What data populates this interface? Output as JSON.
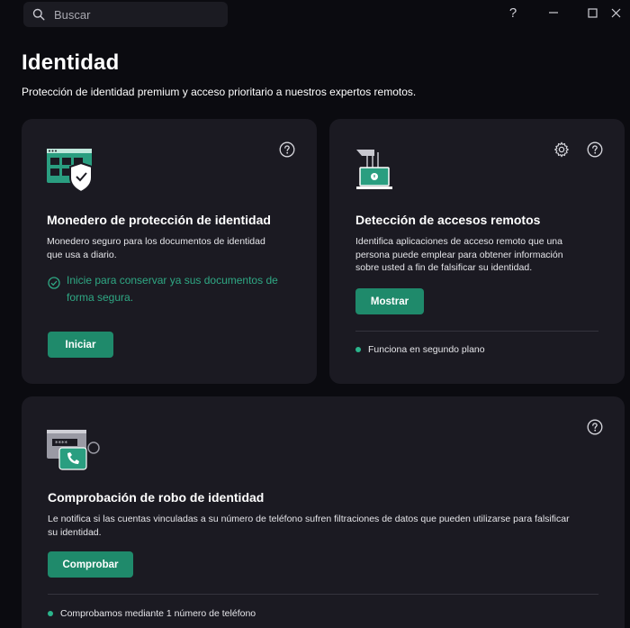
{
  "search": {
    "placeholder": "Buscar"
  },
  "window": {
    "help": "?",
    "minimize": "—",
    "maximize": "☐",
    "close": "✕"
  },
  "page": {
    "title": "Identidad",
    "subtitle": "Protección de identidad premium y acceso prioritario a nuestros expertos remotos."
  },
  "cards": {
    "wallet": {
      "title": "Monedero de protección de identidad",
      "description_line1": "Monedero seguro para los documentos de identidad",
      "description_line2": "que usa a diario.",
      "hint_line1": "Inicie para conservar ya sus documentos de",
      "hint_line2": "forma segura.",
      "button": "Iniciar"
    },
    "remote": {
      "title": "Detección de accesos remotos",
      "description_line1": "Identifica aplicaciones de acceso remoto que una",
      "description_line2": "persona puede emplear para obtener información",
      "description_line3": "sobre usted a fin de falsificar su identidad.",
      "button": "Mostrar",
      "status": "Funciona en segundo plano"
    },
    "theft": {
      "title": "Comprobación de robo de identidad",
      "description_line1": "Le notifica si las cuentas vinculadas a su número de teléfono sufren filtraciones de datos que pueden utilizarse para falsificar",
      "description_line2": "su identidad.",
      "button": "Comprobar",
      "status": "Comprobamos mediante 1 número de teléfono"
    }
  },
  "colors": {
    "accent": "#1f8a6b",
    "status_dot": "#2bb58c",
    "card_bg": "#1b1a22",
    "page_bg": "#0b0b10"
  }
}
